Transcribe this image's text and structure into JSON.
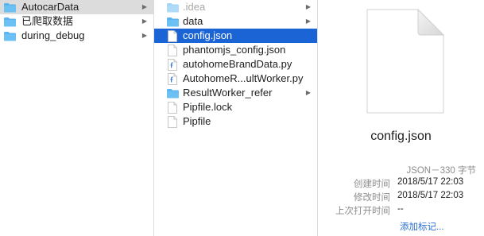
{
  "column1": {
    "items": [
      {
        "label": "AutocarData",
        "selected": true
      },
      {
        "label": "已爬取数据"
      },
      {
        "label": "during_debug"
      }
    ]
  },
  "column2": {
    "items": [
      {
        "label": ".idea",
        "type": "folder",
        "dim": true,
        "has_children": true
      },
      {
        "label": "data",
        "type": "folder",
        "has_children": true
      },
      {
        "label": "config.json",
        "type": "file",
        "selected": true
      },
      {
        "label": "phantomjs_config.json",
        "type": "file"
      },
      {
        "label": "autohomeBrandData.py",
        "type": "python-file"
      },
      {
        "label": "AutohomeR...ultWorker.py",
        "type": "python-file"
      },
      {
        "label": "ResultWorker_refer",
        "type": "folder",
        "has_children": true
      },
      {
        "label": "Pipfile.lock",
        "type": "file"
      },
      {
        "label": "Pipfile",
        "type": "file"
      }
    ]
  },
  "preview": {
    "file_name": "config.json",
    "kind": "JSON－330 字节",
    "created_label": "创建时间",
    "created_value": "2018/5/17 22:03",
    "modified_label": "修改时间",
    "modified_value": "2018/5/17 22:03",
    "last_opened_label": "上次打开时间",
    "last_opened_value": "--",
    "add_tags": "添加标记..."
  },
  "colors": {
    "selection_active": "#1a64d6",
    "selection_inactive": "#dcdcdc",
    "folder": "#5ab4ef",
    "link": "#2a6fd6"
  },
  "arrow_glyph": "▶"
}
